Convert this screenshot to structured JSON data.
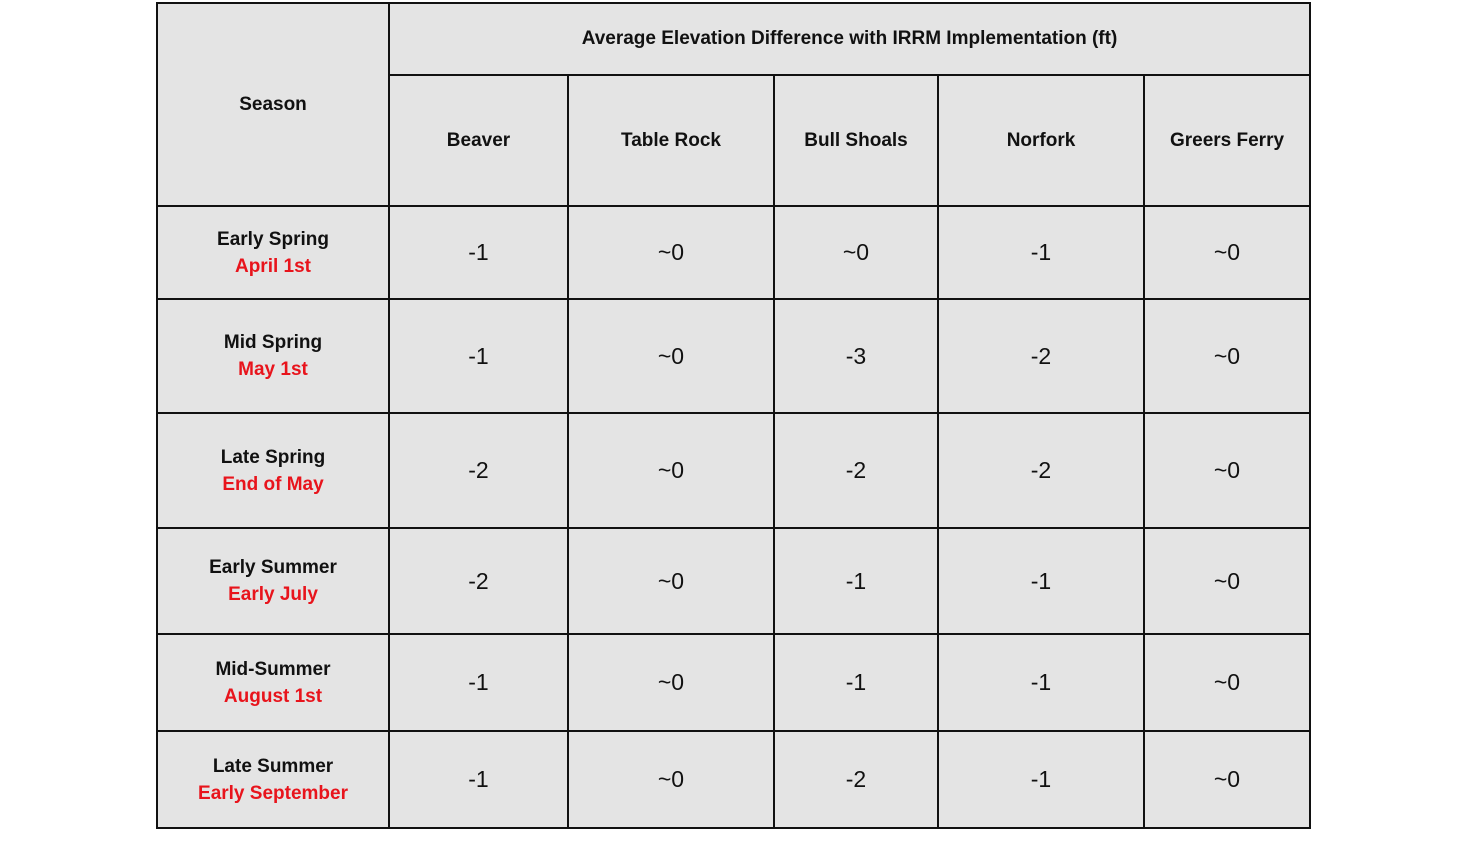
{
  "table": {
    "season_header": "Season",
    "group_header": "Average Elevation Difference with IRRM Implementation (ft)",
    "columns": [
      "Beaver",
      "Table Rock",
      "Bull Shoals",
      "Norfork",
      "Greers Ferry"
    ],
    "rows": [
      {
        "season": "Early Spring",
        "date": "April 1st",
        "values": [
          "-1",
          "~0",
          "~0",
          "-1",
          "~0"
        ]
      },
      {
        "season": "Mid Spring",
        "date": "May 1st",
        "values": [
          "-1",
          "~0",
          "-3",
          "-2",
          "~0"
        ]
      },
      {
        "season": "Late Spring",
        "date": "End of May",
        "values": [
          "-2",
          "~0",
          "-2",
          "-2",
          "~0"
        ]
      },
      {
        "season": "Early Summer",
        "date": "Early July",
        "values": [
          "-2",
          "~0",
          "-1",
          "-1",
          "~0"
        ]
      },
      {
        "season": "Mid-Summer",
        "date": "August 1st",
        "values": [
          "-1",
          "~0",
          "-1",
          "-1",
          "~0"
        ]
      },
      {
        "season": "Late Summer",
        "date": "Early September",
        "values": [
          "-1",
          "~0",
          "-2",
          "-1",
          "~0"
        ]
      }
    ]
  },
  "colors": {
    "date_text": "#e8141c",
    "cell_background": "#e4e4e4",
    "border": "#111111"
  }
}
